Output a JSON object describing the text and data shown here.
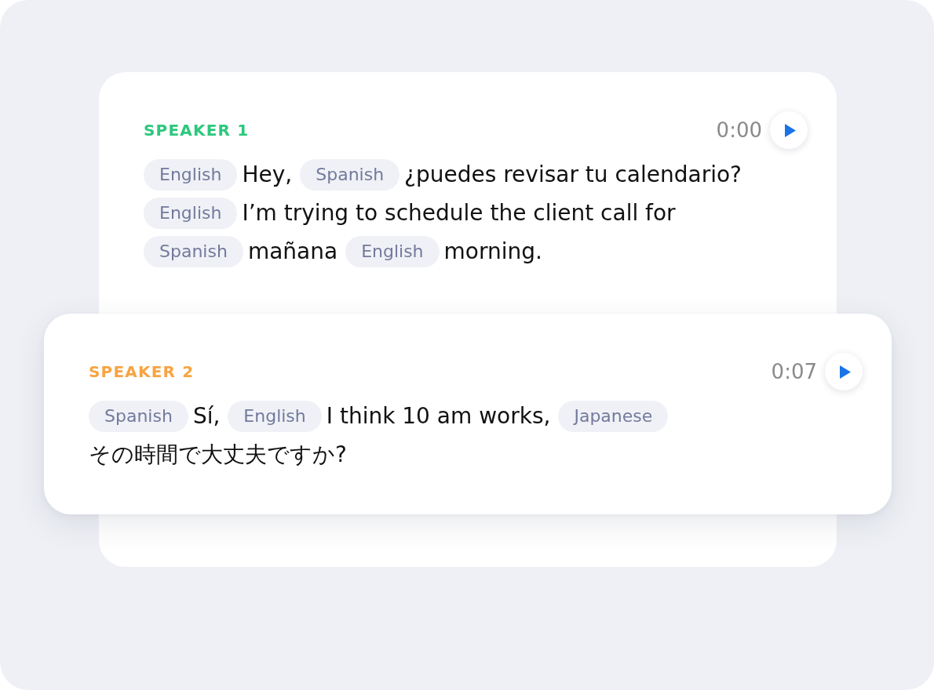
{
  "entries": [
    {
      "speaker": "SPEAKER 1",
      "color": "#2cc87c",
      "time": "0:00",
      "elevated": false,
      "segments": [
        {
          "language": "English",
          "text": "Hey,"
        },
        {
          "language": "Spanish",
          "text": "¿puedes revisar tu calendario?"
        },
        {
          "language": "English",
          "text": "I’m trying to schedule the client call for"
        },
        {
          "language": "Spanish",
          "text": "mañana"
        },
        {
          "language": "English",
          "text": "morning."
        }
      ]
    },
    {
      "speaker": "SPEAKER 2",
      "color": "#f7a444",
      "time": "0:07",
      "elevated": true,
      "segments": [
        {
          "language": "Spanish",
          "text": "Sí,"
        },
        {
          "language": "English",
          "text": "I think 10 am works,"
        },
        {
          "language": "Japanese",
          "text": "その時間で大丈夫ですか?"
        }
      ]
    }
  ]
}
